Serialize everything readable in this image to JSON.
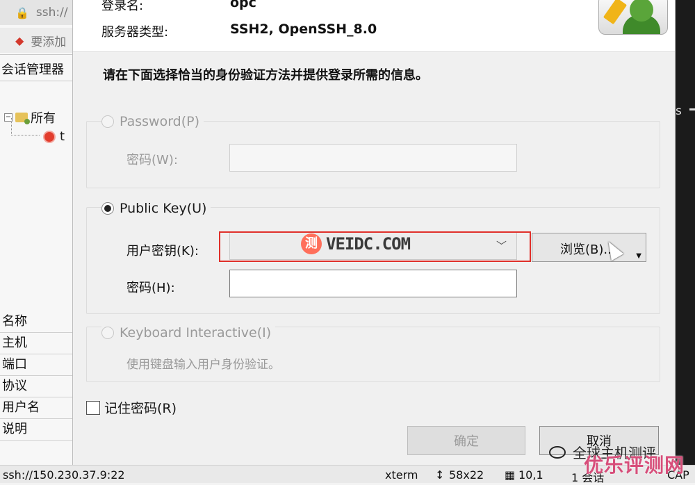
{
  "background": {
    "tabs": [
      {
        "icon": "lock-icon",
        "label": "ssh://"
      },
      {
        "icon": "bookmark-icon",
        "label": "要添加"
      }
    ],
    "session_manager_title": "会话管理器",
    "tree": {
      "root_label": "所有",
      "child_label": "t"
    },
    "properties": [
      "名称",
      "主机",
      "端口",
      "协议",
      "用户名",
      "说明"
    ],
    "terminal_fragment": "s"
  },
  "dialog": {
    "header": {
      "login_name_label": "登录名:",
      "login_name_value": "opc",
      "server_type_label": "服务器类型:",
      "server_type_value": "SSH2, OpenSSH_8.0"
    },
    "instruction": "请在下面选择恰当的身份验证方法并提供登录所需的信息。",
    "password_method": {
      "label": "Password(P)",
      "selected": false,
      "enabled": false,
      "password_label": "密码(W):",
      "password_value": ""
    },
    "public_key_method": {
      "label": "Public Key(U)",
      "selected": true,
      "enabled": true,
      "user_key_label": "用户密钥(K):",
      "user_key_value": "",
      "browse_label": "浏览(B)...",
      "passphrase_label": "密码(H):",
      "passphrase_value": ""
    },
    "keyboard_method": {
      "label": "Keyboard Interactive(I)",
      "selected": false,
      "enabled": false,
      "description": "使用键盘输入用户身份验证。"
    },
    "remember_password": {
      "label": "记住密码(R)",
      "checked": false
    },
    "ok_label": "确定",
    "cancel_label": "取消",
    "accent_color": "#e0302a"
  },
  "watermarks": {
    "center_badge": "测",
    "center_text": "VEIDC.COM",
    "wechat_text": "全球主机测评",
    "corner_text": "优乐评测网"
  },
  "statusbar": {
    "connection": "ssh://150.230.37.9:22",
    "terminal_type": "xterm",
    "size": "58x22",
    "cursor_pos": "10,1",
    "sessions": "1 会话",
    "caps": "CAP"
  }
}
